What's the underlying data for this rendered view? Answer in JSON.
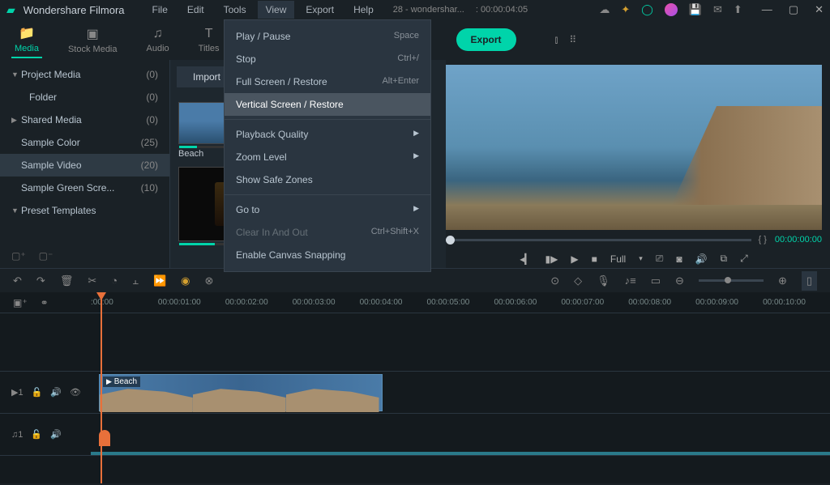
{
  "app": {
    "title": "Wondershare Filmora"
  },
  "menubar": [
    "File",
    "Edit",
    "Tools",
    "View",
    "Export",
    "Help"
  ],
  "project": {
    "name": "28 - wondershar...",
    "timecode": "00:00:04:05"
  },
  "tabs": [
    {
      "label": "Media",
      "active": true
    },
    {
      "label": "Stock Media"
    },
    {
      "label": "Audio"
    },
    {
      "label": "Titles"
    }
  ],
  "export_label": "Export",
  "sidebar": {
    "items": [
      {
        "label": "Project Media",
        "count": "(0)",
        "chevron": "▼"
      },
      {
        "label": "Folder",
        "count": "(0)",
        "chevron": "",
        "indent": true
      },
      {
        "label": "Shared Media",
        "count": "(0)",
        "chevron": "▶"
      },
      {
        "label": "Sample Color",
        "count": "(25)",
        "chevron": ""
      },
      {
        "label": "Sample Video",
        "count": "(20)",
        "chevron": "",
        "selected": true
      },
      {
        "label": "Sample Green Scre...",
        "count": "(10)",
        "chevron": ""
      },
      {
        "label": "Preset Templates",
        "count": "",
        "chevron": "▼"
      }
    ]
  },
  "import_label": "Import",
  "media": [
    {
      "label": "Beach"
    },
    {
      "label": ""
    }
  ],
  "view_menu": [
    {
      "label": "Play / Pause",
      "shortcut": "Space"
    },
    {
      "label": "Stop",
      "shortcut": "Ctrl+/"
    },
    {
      "label": "Full Screen / Restore",
      "shortcut": "Alt+Enter"
    },
    {
      "label": "Vertical Screen / Restore",
      "shortcut": "",
      "hover": true
    },
    {
      "sep": true
    },
    {
      "label": "Playback Quality",
      "submenu": true
    },
    {
      "label": "Zoom Level",
      "submenu": true
    },
    {
      "label": "Show Safe Zones"
    },
    {
      "sep": true
    },
    {
      "label": "Go to",
      "submenu": true
    },
    {
      "label": "Clear In And Out",
      "shortcut": "Ctrl+Shift+X",
      "disabled": true
    },
    {
      "label": "Enable Canvas Snapping"
    }
  ],
  "preview": {
    "inout": "{       }",
    "timecode": "00:00:00:00",
    "quality": "Full"
  },
  "timeruler": [
    ":00:00",
    "00:00:01:00",
    "00:00:02:00",
    "00:00:03:00",
    "00:00:04:00",
    "00:00:05:00",
    "00:00:06:00",
    "00:00:07:00",
    "00:00:08:00",
    "00:00:09:00",
    "00:00:10:00"
  ],
  "tracks": {
    "video": "▶1",
    "audio": "♫1"
  },
  "clip": {
    "name": "Beach"
  }
}
